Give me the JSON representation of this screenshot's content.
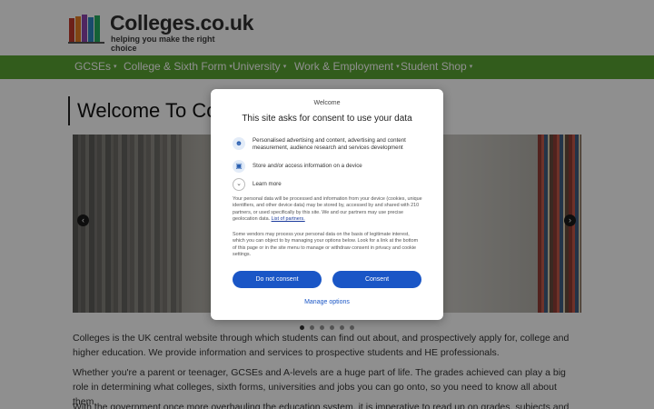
{
  "site": {
    "logo_title": "Colleges.co.uk",
    "logo_tagline": "helping you make the right choice"
  },
  "nav": {
    "items": [
      {
        "label": "GCSEs"
      },
      {
        "label": "College & Sixth Form"
      },
      {
        "label": "University"
      },
      {
        "label": "Work & Employment"
      },
      {
        "label": "Student Shop"
      }
    ],
    "caret": "▾"
  },
  "main": {
    "title": "Welcome To Colleges.co.uk",
    "paragraphs": [
      "Colleges is the UK central website through which students can find out about, and prospectively apply for, college and higher education. We provide information and services to prospective students and HE professionals.",
      "Whether you're a parent or teenager, GCSEs and A-levels are a huge part of life. The grades achieved can play a big role in determining what colleges, sixth forms, universities and jobs you can go onto, so you need to know all about them.",
      "With the government once more overhauling the education system, it is imperative to read up on grades, subjects and university, to"
    ],
    "carousel": {
      "prev": "‹",
      "next": "›",
      "slide_count": 6,
      "active_slide": 1
    }
  },
  "consent": {
    "welcome": "Welcome",
    "title": "This site asks for consent to use your data",
    "purposes": [
      {
        "icon": "person-icon",
        "text": "Personalised advertising and content, advertising and content measurement, audience research and services development"
      },
      {
        "icon": "device-storage-icon",
        "text": "Store and/or access information on a device"
      }
    ],
    "learn_more": "Learn more",
    "body_1": "Your personal data will be processed and information from your device (cookies, unique identifiers, and other device data) may be stored by, accessed by and shared with 210 partners, or used specifically by this site. We and our partners may use precise geolocation data. ",
    "partners_link": "List of partners.",
    "body_2": "Some vendors may process your personal data on the basis of legitimate interest, which you can object to by managing your options below. Look for a link at the bottom of this page or in the site menu to manage or withdraw consent in privacy and cookie settings.",
    "do_not_consent": "Do not consent",
    "consent": "Consent",
    "manage_options": "Manage options"
  },
  "colors": {
    "nav_green": "#5aa532",
    "consent_blue": "#1a56c6"
  }
}
